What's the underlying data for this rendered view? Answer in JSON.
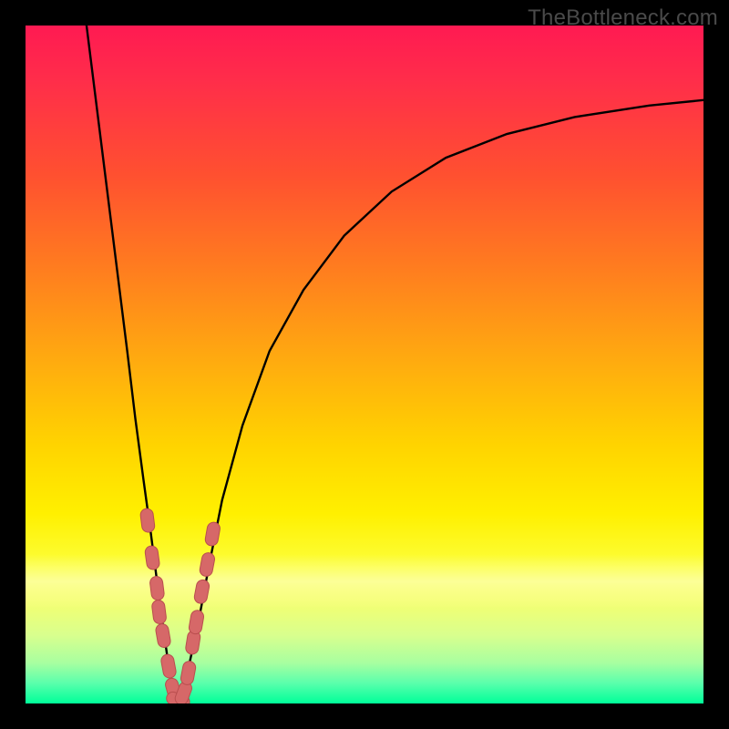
{
  "watermark": {
    "text": "TheBottleneck.com"
  },
  "colors": {
    "frame": "#000000",
    "curve": "#000000",
    "marker_fill": "#d66868",
    "marker_stroke": "#b94e4e"
  },
  "chart_data": {
    "type": "line",
    "title": "",
    "xlabel": "",
    "ylabel": "",
    "xlim": [
      0,
      100
    ],
    "ylim": [
      0,
      100
    ],
    "curve_left": {
      "note": "steep descending branch from top-left into valley",
      "x": [
        9,
        10.5,
        12,
        13.5,
        15,
        16.2,
        17.4,
        18.5,
        19.4,
        20.2,
        20.9,
        21.5,
        22.1,
        22.5
      ],
      "y": [
        100,
        88,
        76,
        64,
        52,
        42,
        33,
        25,
        18,
        12,
        7,
        3.5,
        1.2,
        0
      ]
    },
    "curve_right": {
      "note": "ascending branch rising out of valley and flattening toward right",
      "x": [
        22.5,
        23.2,
        24.2,
        25.5,
        27,
        29,
        32,
        36,
        41,
        47,
        54,
        62,
        71,
        81,
        92,
        100
      ],
      "y": [
        0,
        2,
        6,
        12,
        20,
        30,
        41,
        52,
        61,
        69,
        75.5,
        80.5,
        84,
        86.5,
        88.2,
        89
      ]
    },
    "markers": {
      "note": "salmon pill-shaped markers clustered near the valley bottom on both branches",
      "points": [
        {
          "x": 18.0,
          "y": 27.0,
          "branch": "left"
        },
        {
          "x": 18.7,
          "y": 21.5,
          "branch": "left"
        },
        {
          "x": 19.4,
          "y": 17.0,
          "branch": "left"
        },
        {
          "x": 19.7,
          "y": 13.5,
          "branch": "left"
        },
        {
          "x": 20.3,
          "y": 10.0,
          "branch": "left"
        },
        {
          "x": 21.1,
          "y": 5.5,
          "branch": "left"
        },
        {
          "x": 21.8,
          "y": 2.0,
          "branch": "left"
        },
        {
          "x": 22.5,
          "y": 0.5,
          "branch": "valley"
        },
        {
          "x": 23.3,
          "y": 1.5,
          "branch": "right"
        },
        {
          "x": 24.0,
          "y": 4.5,
          "branch": "right"
        },
        {
          "x": 24.7,
          "y": 9.0,
          "branch": "right"
        },
        {
          "x": 25.2,
          "y": 12.0,
          "branch": "right"
        },
        {
          "x": 26.0,
          "y": 16.5,
          "branch": "right"
        },
        {
          "x": 26.8,
          "y": 20.5,
          "branch": "right"
        },
        {
          "x": 27.6,
          "y": 25.0,
          "branch": "right"
        }
      ]
    }
  }
}
